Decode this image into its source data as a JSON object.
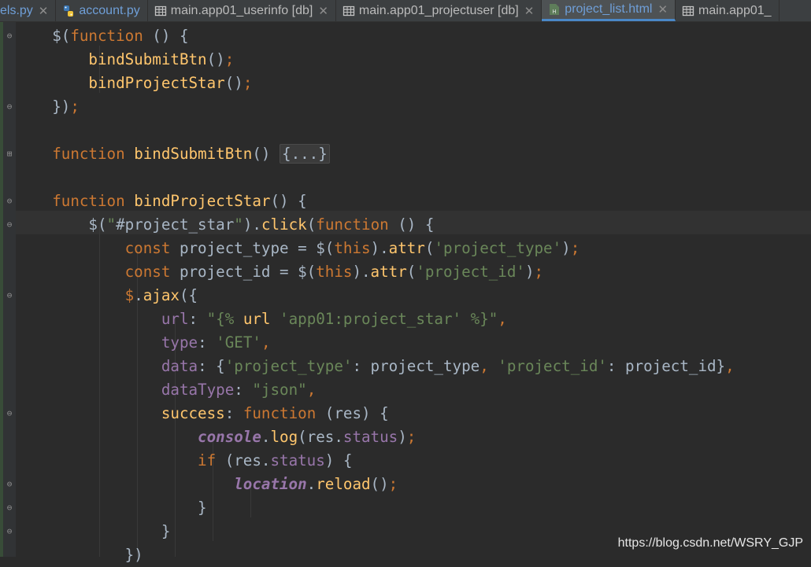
{
  "tabs": [
    {
      "label": "els.py",
      "kind": "py",
      "icon": "none",
      "closable": true
    },
    {
      "label": "account.py",
      "kind": "py",
      "icon": "python-file-icon",
      "closable": false
    },
    {
      "label": "main.app01_userinfo [db]",
      "kind": "db",
      "icon": "table-icon",
      "closable": true
    },
    {
      "label": "main.app01_projectuser [db]",
      "kind": "db",
      "icon": "table-icon",
      "closable": true
    },
    {
      "label": "project_list.html",
      "kind": "html",
      "icon": "html-file-icon",
      "closable": true,
      "active": true
    },
    {
      "label": "main.app01_",
      "kind": "db",
      "icon": "table-icon",
      "closable": false
    }
  ],
  "editor": {
    "lines": [
      [
        {
          "t": "    ",
          "c": "pun"
        },
        {
          "t": "$(",
          "c": "pun"
        },
        {
          "t": "function",
          "c": "kw"
        },
        {
          "t": " () {",
          "c": "pun"
        }
      ],
      [
        {
          "t": "        ",
          "c": "pun"
        },
        {
          "t": "bindSubmitBtn",
          "c": "fn"
        },
        {
          "t": "()",
          "c": "pun"
        },
        {
          "t": ";",
          "c": "kw"
        }
      ],
      [
        {
          "t": "        ",
          "c": "pun"
        },
        {
          "t": "bindProjectStar",
          "c": "fn"
        },
        {
          "t": "()",
          "c": "pun"
        },
        {
          "t": ";",
          "c": "kw"
        }
      ],
      [
        {
          "t": "    ",
          "c": "pun"
        },
        {
          "t": "})",
          "c": "pun"
        },
        {
          "t": ";",
          "c": "kw"
        }
      ],
      [],
      [
        {
          "t": "    ",
          "c": "pun"
        },
        {
          "t": "function ",
          "c": "kw"
        },
        {
          "t": "bindSubmitBtn",
          "c": "fn"
        },
        {
          "t": "() ",
          "c": "pun"
        },
        {
          "t": "{...}",
          "c": "folded"
        }
      ],
      [],
      [
        {
          "t": "    ",
          "c": "pun"
        },
        {
          "t": "function ",
          "c": "kw"
        },
        {
          "t": "bindProjectStar",
          "c": "fn"
        },
        {
          "t": "() {",
          "c": "pun"
        }
      ],
      [
        {
          "t": "        ",
          "c": "pun"
        },
        {
          "t": "$(",
          "c": "pun"
        },
        {
          "t": "\"",
          "c": "str"
        },
        {
          "t": "#project_star",
          "c": "id"
        },
        {
          "t": "\"",
          "c": "str"
        },
        {
          "t": ").",
          "c": "pun"
        },
        {
          "t": "click",
          "c": "fn"
        },
        {
          "t": "(",
          "c": "pun"
        },
        {
          "t": "function",
          "c": "kw"
        },
        {
          "t": " () {",
          "c": "pun"
        }
      ],
      [
        {
          "t": "            ",
          "c": "pun"
        },
        {
          "t": "const ",
          "c": "kw"
        },
        {
          "t": "project_type = $(",
          "c": "pun"
        },
        {
          "t": "this",
          "c": "kw"
        },
        {
          "t": ").",
          "c": "pun"
        },
        {
          "t": "attr",
          "c": "fn"
        },
        {
          "t": "(",
          "c": "pun"
        },
        {
          "t": "'project_type'",
          "c": "str"
        },
        {
          "t": ")",
          "c": "pun"
        },
        {
          "t": ";",
          "c": "kw"
        }
      ],
      [
        {
          "t": "            ",
          "c": "pun"
        },
        {
          "t": "const ",
          "c": "kw"
        },
        {
          "t": "project_id = $(",
          "c": "pun"
        },
        {
          "t": "this",
          "c": "kw"
        },
        {
          "t": ").",
          "c": "pun"
        },
        {
          "t": "attr",
          "c": "fn"
        },
        {
          "t": "(",
          "c": "pun"
        },
        {
          "t": "'project_id'",
          "c": "str"
        },
        {
          "t": ")",
          "c": "pun"
        },
        {
          "t": ";",
          "c": "kw"
        }
      ],
      [
        {
          "t": "            ",
          "c": "pun"
        },
        {
          "t": "$",
          "c": "kw"
        },
        {
          "t": ".",
          "c": "pun"
        },
        {
          "t": "ajax",
          "c": "fn"
        },
        {
          "t": "({",
          "c": "pun"
        }
      ],
      [
        {
          "t": "                ",
          "c": "pun"
        },
        {
          "t": "url",
          "c": "prop"
        },
        {
          "t": ": ",
          "c": "pun"
        },
        {
          "t": "\"{% ",
          "c": "str"
        },
        {
          "t": "url ",
          "c": "fn"
        },
        {
          "t": "'app01:project_star' ",
          "c": "str"
        },
        {
          "t": "%}\"",
          "c": "str"
        },
        {
          "t": ",",
          "c": "kw"
        }
      ],
      [
        {
          "t": "                ",
          "c": "pun"
        },
        {
          "t": "type",
          "c": "prop"
        },
        {
          "t": ": ",
          "c": "pun"
        },
        {
          "t": "'GET'",
          "c": "str"
        },
        {
          "t": ",",
          "c": "kw"
        }
      ],
      [
        {
          "t": "                ",
          "c": "pun"
        },
        {
          "t": "data",
          "c": "prop"
        },
        {
          "t": ": {",
          "c": "pun"
        },
        {
          "t": "'project_type'",
          "c": "str"
        },
        {
          "t": ": project_type",
          "c": "pun"
        },
        {
          "t": ", ",
          "c": "kw"
        },
        {
          "t": "'project_id'",
          "c": "str"
        },
        {
          "t": ": project_id}",
          "c": "pun"
        },
        {
          "t": ",",
          "c": "kw"
        }
      ],
      [
        {
          "t": "                ",
          "c": "pun"
        },
        {
          "t": "dataType",
          "c": "prop"
        },
        {
          "t": ": ",
          "c": "pun"
        },
        {
          "t": "\"json\"",
          "c": "str"
        },
        {
          "t": ",",
          "c": "kw"
        }
      ],
      [
        {
          "t": "                ",
          "c": "pun"
        },
        {
          "t": "success",
          "c": "fn"
        },
        {
          "t": ": ",
          "c": "pun"
        },
        {
          "t": "function ",
          "c": "kw"
        },
        {
          "t": "(res) {",
          "c": "pun"
        }
      ],
      [
        {
          "t": "                    ",
          "c": "pun"
        },
        {
          "t": "console",
          "c": "glob"
        },
        {
          "t": ".",
          "c": "pun"
        },
        {
          "t": "log",
          "c": "fn"
        },
        {
          "t": "(res.",
          "c": "pun"
        },
        {
          "t": "status",
          "c": "prop"
        },
        {
          "t": ")",
          "c": "pun"
        },
        {
          "t": ";",
          "c": "kw"
        }
      ],
      [
        {
          "t": "                    ",
          "c": "pun"
        },
        {
          "t": "if ",
          "c": "kw"
        },
        {
          "t": "(res.",
          "c": "pun"
        },
        {
          "t": "status",
          "c": "prop"
        },
        {
          "t": ") {",
          "c": "pun"
        }
      ],
      [
        {
          "t": "                        ",
          "c": "pun"
        },
        {
          "t": "location",
          "c": "glob"
        },
        {
          "t": ".",
          "c": "pun"
        },
        {
          "t": "reload",
          "c": "fn"
        },
        {
          "t": "()",
          "c": "pun"
        },
        {
          "t": ";",
          "c": "kw"
        }
      ],
      [
        {
          "t": "                    ",
          "c": "pun"
        },
        {
          "t": "}",
          "c": "pun"
        }
      ],
      [
        {
          "t": "                ",
          "c": "pun"
        },
        {
          "t": "}",
          "c": "pun"
        }
      ],
      [
        {
          "t": "            ",
          "c": "pun"
        },
        {
          "t": "})",
          "c": "pun"
        }
      ]
    ]
  },
  "watermark": "https://blog.csdn.net/WSRY_GJP",
  "colors": {
    "background": "#2b2b2b",
    "keyword": "#cc7832",
    "function": "#ffc66d",
    "string": "#6a8759",
    "property": "#9876aa",
    "text": "#a9b7c6"
  }
}
